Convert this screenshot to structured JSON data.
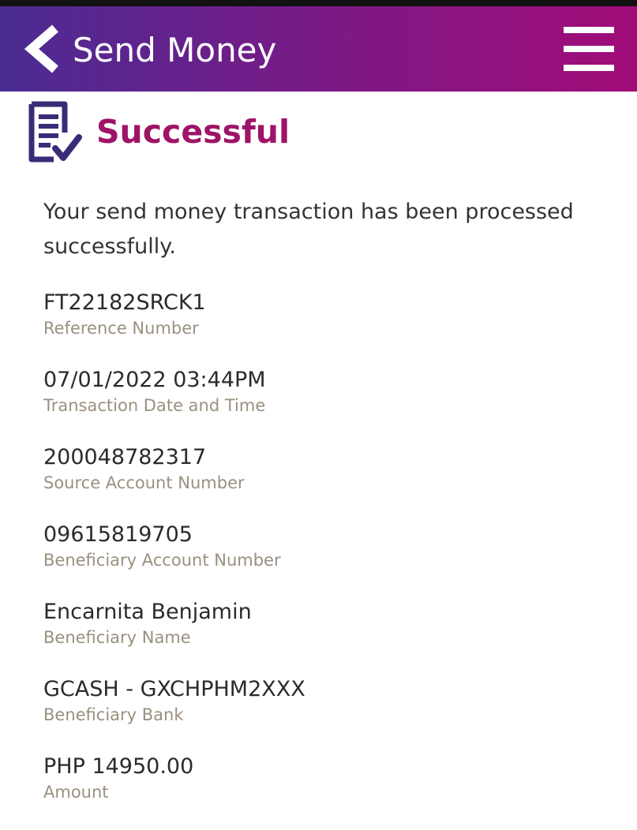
{
  "header": {
    "title": "Send Money",
    "gradient_start": "#4a2c93",
    "gradient_end": "#a10c78",
    "back_icon": "chevron-left-icon",
    "menu_icon": "hamburger-menu-icon"
  },
  "status": {
    "title": "Successful",
    "icon": "receipt-check-icon",
    "title_color": "#9e1466",
    "icon_color": "#3b2a78"
  },
  "message": "Your send money transaction has been processed successfully.",
  "details": [
    {
      "value": "FT22182SRCK1",
      "label": "Reference Number"
    },
    {
      "value": "07/01/2022 03:44PM",
      "label": "Transaction Date and Time"
    },
    {
      "value": "200048782317",
      "label": "Source Account Number"
    },
    {
      "value": "09615819705",
      "label": "Beneficiary Account Number"
    },
    {
      "value": "Encarnita Benjamin",
      "label": "Beneficiary Name"
    },
    {
      "value": "GCASH - GXCHPHM2XXX",
      "label": "Beneficiary Bank"
    },
    {
      "value": "PHP 14950.00",
      "label": "Amount"
    }
  ],
  "colors": {
    "value_text": "#2b2b2b",
    "label_text": "#9a907f"
  }
}
